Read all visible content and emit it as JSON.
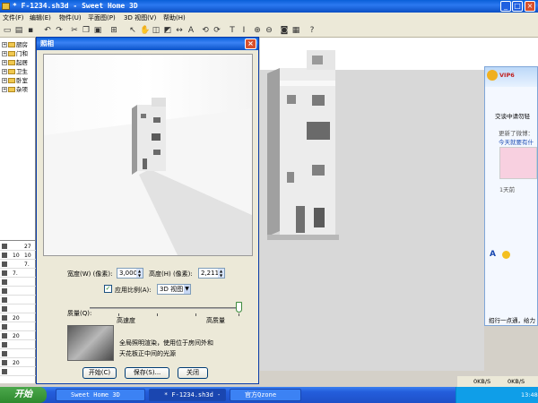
{
  "window": {
    "title": "* F-1234.sh3d - Sweet Home 3D",
    "minimize": "_",
    "maximize": "□",
    "close": "×"
  },
  "menu": [
    "文件(F)",
    "编辑(E)",
    "物件(U)",
    "平面图(P)",
    "3D 视图(V)",
    "帮助(H)"
  ],
  "tree": {
    "items": [
      "厨房",
      "门和",
      "起居",
      "卫生",
      "卧室",
      "杂项"
    ]
  },
  "furniture_rows": [
    {
      "c1": "",
      "c2": "27"
    },
    {
      "c1": "10",
      "c2": "10"
    },
    {
      "c1": "",
      "c2": "7."
    },
    {
      "c1": "7.",
      "c2": ""
    },
    {
      "c1": "",
      "c2": ""
    },
    {
      "c1": "",
      "c2": ""
    },
    {
      "c1": "",
      "c2": ""
    },
    {
      "c1": "",
      "c2": ""
    },
    {
      "c1": "20",
      "c2": ""
    },
    {
      "c1": "",
      "c2": ""
    },
    {
      "c1": "20",
      "c2": ""
    },
    {
      "c1": "",
      "c2": ""
    },
    {
      "c1": "",
      "c2": ""
    },
    {
      "c1": "20",
      "c2": ""
    },
    {
      "c1": "",
      "c2": ""
    }
  ],
  "dialog": {
    "title": "照相",
    "close": "×",
    "width_label": "宽度(W) (像素):",
    "width_value": "3,000",
    "height_label": "高度(H) (像素):",
    "height_value": "2,211",
    "apply_ratio_label": "应用比例(A):",
    "apply_ratio_checked": true,
    "check_mark": "✓",
    "ratio_option": "3D 视图",
    "quality_label": "质量(Q):",
    "fast_label": "高速度",
    "best_label": "高质量",
    "quality_level": 1.0,
    "quality_desc_line1": "全局照明渲染，使用位于房间外和",
    "quality_desc_line2": "天花板正中间的光源",
    "start_button": "开始(C)",
    "save_button": "保存(S)...",
    "close_button": "关闭"
  },
  "chat": {
    "name": "VIP6",
    "line1": "交谈中请勿轻",
    "line2": "更新了微博：",
    "line3": "今天就要有什",
    "line4": "1天前",
    "line5": "招行一点通，给力",
    "font_icon": "A"
  },
  "status": {
    "net1": "0KB/S",
    "net2": "0KB/S"
  },
  "taskbar": {
    "start": "开始",
    "tasks": [
      "Sweet Home 3D",
      "* F-1234.sh3d - ...",
      "官方Qzone"
    ],
    "time": "13:48"
  },
  "colors": {
    "titlebar": "#0a5fd8",
    "taskbar": "#245edc",
    "start": "#2e8a2e",
    "dialog_bg": "#ece9d8"
  }
}
